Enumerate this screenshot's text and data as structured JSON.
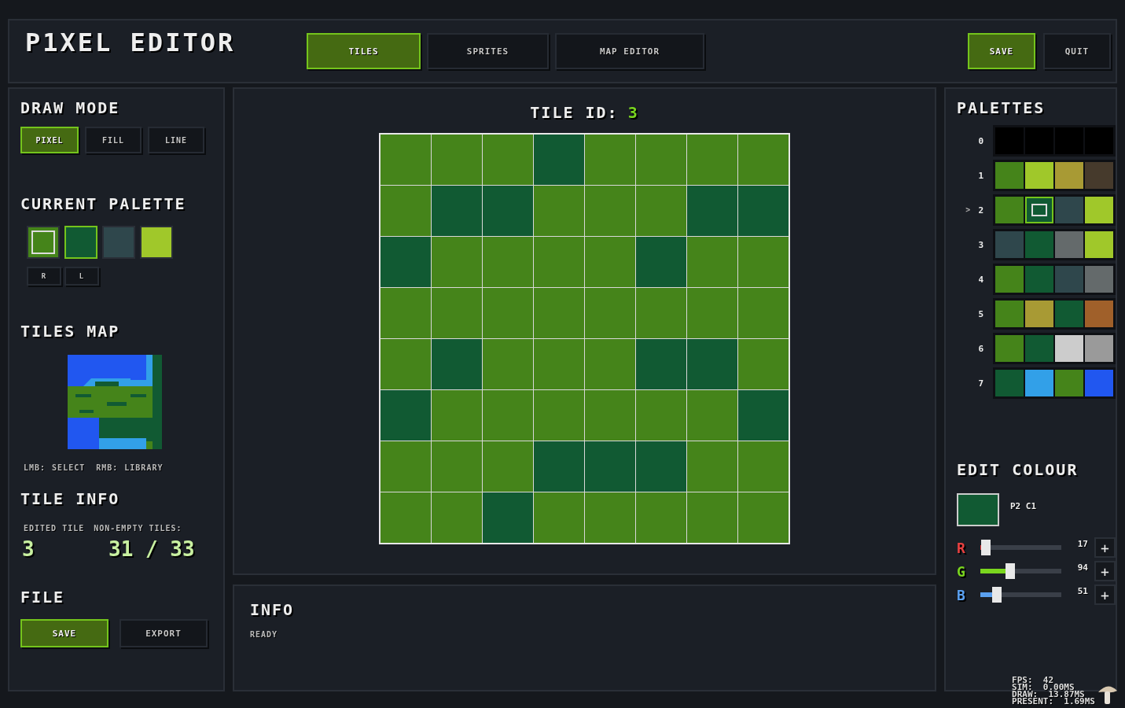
{
  "title": "P1XEL EDITOR",
  "tabs": [
    {
      "label": "TILES",
      "selected": true
    },
    {
      "label": "SPRITES",
      "selected": false
    },
    {
      "label": "MAP EDITOR",
      "selected": false
    }
  ],
  "actions": [
    {
      "label": "SAVE",
      "primary": true
    },
    {
      "label": "QUIT",
      "primary": false
    }
  ],
  "draw_mode": {
    "title": "DRAW MODE",
    "modes": [
      {
        "label": "PIXEL",
        "selected": true
      },
      {
        "label": "FILL",
        "selected": false
      },
      {
        "label": "LINE",
        "selected": false
      }
    ]
  },
  "current_palette": {
    "title": "CURRENT PALETTE",
    "swatches": [
      {
        "color": "#45841a",
        "selected": true,
        "highlighted": false
      },
      {
        "color": "#115a33",
        "selected": false,
        "highlighted": true
      },
      {
        "color": "#2f474c",
        "selected": false,
        "highlighted": false
      },
      {
        "color": "#a0c82a",
        "selected": false,
        "highlighted": false
      }
    ],
    "buttons": [
      "R",
      "L"
    ]
  },
  "tiles_map": {
    "title": "TILES MAP",
    "hint_parts": [
      "LMB:",
      "SELECT",
      "RMB:",
      "LIBRARY"
    ]
  },
  "tile_info": {
    "title": "TILE INFO",
    "edited_label": "EDITED TILE",
    "edited_value": "3",
    "nonempty_label": "NON-EMPTY TILES:",
    "nonempty_value": "31 / 33"
  },
  "file": {
    "title": "FILE",
    "buttons": [
      {
        "label": "SAVE",
        "primary": true
      },
      {
        "label": "EXPORT",
        "primary": false
      }
    ]
  },
  "tile": {
    "label": "TILE ID:",
    "id": "3",
    "rows": [
      [
        {
          "color": "#45841a"
        },
        {
          "color": "#45841a"
        },
        {
          "color": "#45841a"
        },
        {
          "color": "#115a33"
        },
        {
          "color": "#45841a"
        },
        {
          "color": "#45841a"
        },
        {
          "color": "#45841a"
        },
        {
          "color": "#45841a"
        }
      ],
      [
        {
          "color": "#45841a"
        },
        {
          "color": "#115a33"
        },
        {
          "color": "#115a33"
        },
        {
          "color": "#45841a"
        },
        {
          "color": "#45841a"
        },
        {
          "color": "#45841a"
        },
        {
          "color": "#115a33"
        },
        {
          "color": "#115a33"
        }
      ],
      [
        {
          "color": "#115a33"
        },
        {
          "color": "#45841a"
        },
        {
          "color": "#45841a"
        },
        {
          "color": "#45841a"
        },
        {
          "color": "#45841a"
        },
        {
          "color": "#115a33"
        },
        {
          "color": "#45841a"
        },
        {
          "color": "#45841a"
        }
      ],
      [
        {
          "color": "#45841a"
        },
        {
          "color": "#45841a"
        },
        {
          "color": "#45841a"
        },
        {
          "color": "#45841a"
        },
        {
          "color": "#45841a"
        },
        {
          "color": "#45841a"
        },
        {
          "color": "#45841a"
        },
        {
          "color": "#45841a"
        }
      ],
      [
        {
          "color": "#45841a"
        },
        {
          "color": "#115a33"
        },
        {
          "color": "#45841a"
        },
        {
          "color": "#45841a"
        },
        {
          "color": "#45841a"
        },
        {
          "color": "#115a33"
        },
        {
          "color": "#115a33"
        },
        {
          "color": "#45841a"
        }
      ],
      [
        {
          "color": "#115a33"
        },
        {
          "color": "#45841a"
        },
        {
          "color": "#45841a"
        },
        {
          "color": "#45841a"
        },
        {
          "color": "#45841a"
        },
        {
          "color": "#45841a"
        },
        {
          "color": "#45841a"
        },
        {
          "color": "#115a33"
        }
      ],
      [
        {
          "color": "#45841a"
        },
        {
          "color": "#45841a"
        },
        {
          "color": "#45841a"
        },
        {
          "color": "#115a33"
        },
        {
          "color": "#115a33"
        },
        {
          "color": "#115a33"
        },
        {
          "color": "#45841a"
        },
        {
          "color": "#45841a"
        }
      ],
      [
        {
          "color": "#45841a"
        },
        {
          "color": "#45841a"
        },
        {
          "color": "#115a33"
        },
        {
          "color": "#45841a"
        },
        {
          "color": "#45841a"
        },
        {
          "color": "#45841a"
        },
        {
          "color": "#45841a"
        },
        {
          "color": "#45841a"
        }
      ]
    ]
  },
  "info": {
    "title": "INFO",
    "status": "READY"
  },
  "palettes": {
    "title": "PALETTES",
    "marker": ">",
    "rows": [
      {
        "label": "0",
        "selected": false,
        "colors": [
          {
            "color": "#000000",
            "selected": false
          },
          {
            "color": "#000000",
            "selected": false
          },
          {
            "color": "#000000",
            "selected": false
          },
          {
            "color": "#000000",
            "selected": false
          }
        ]
      },
      {
        "label": "1",
        "selected": false,
        "colors": [
          {
            "color": "#45841a",
            "selected": false
          },
          {
            "color": "#a0c82a",
            "selected": false
          },
          {
            "color": "#a89a34",
            "selected": false
          },
          {
            "color": "#463a2c",
            "selected": false
          }
        ]
      },
      {
        "label": "2",
        "selected": true,
        "colors": [
          {
            "color": "#45841a",
            "selected": false
          },
          {
            "color": "#115a33",
            "selected": true
          },
          {
            "color": "#2f474c",
            "selected": false
          },
          {
            "color": "#a0c82a",
            "selected": false
          }
        ]
      },
      {
        "label": "3",
        "selected": false,
        "colors": [
          {
            "color": "#2f474c",
            "selected": false
          },
          {
            "color": "#115a33",
            "selected": false
          },
          {
            "color": "#646a6b",
            "selected": false
          },
          {
            "color": "#a0c82a",
            "selected": false
          }
        ]
      },
      {
        "label": "4",
        "selected": false,
        "colors": [
          {
            "color": "#45841a",
            "selected": false
          },
          {
            "color": "#115a33",
            "selected": false
          },
          {
            "color": "#2f474c",
            "selected": false
          },
          {
            "color": "#646a6b",
            "selected": false
          }
        ]
      },
      {
        "label": "5",
        "selected": false,
        "colors": [
          {
            "color": "#45841a",
            "selected": false
          },
          {
            "color": "#a89a34",
            "selected": false
          },
          {
            "color": "#115a33",
            "selected": false
          },
          {
            "color": "#a0602a",
            "selected": false
          }
        ]
      },
      {
        "label": "6",
        "selected": false,
        "colors": [
          {
            "color": "#45841a",
            "selected": false
          },
          {
            "color": "#115a33",
            "selected": false
          },
          {
            "color": "#cccccc",
            "selected": false
          },
          {
            "color": "#9a9a9a",
            "selected": false
          }
        ]
      },
      {
        "label": "7",
        "selected": false,
        "colors": [
          {
            "color": "#115a33",
            "selected": false
          },
          {
            "color": "#32a0e8",
            "selected": false
          },
          {
            "color": "#45841a",
            "selected": false
          },
          {
            "color": "#2157f0",
            "selected": false
          }
        ]
      }
    ]
  },
  "edit_colour": {
    "title": "EDIT COLOUR",
    "color": "#115a33",
    "label": "P2 C1",
    "channels": [
      {
        "name": "R",
        "color": "#e84040",
        "level": 0.067,
        "value": "17",
        "button": "+"
      },
      {
        "name": "G",
        "color": "#7ad61e",
        "level": 0.369,
        "value": "94",
        "button": "+"
      },
      {
        "name": "B",
        "color": "#5aa0f0",
        "level": 0.2,
        "value": "51",
        "button": "+"
      }
    ]
  },
  "stats": [
    "FPS:  42",
    "SIM:  0.00MS",
    "DRAW:  13.87MS",
    "PRESENT:  1.69MS"
  ]
}
